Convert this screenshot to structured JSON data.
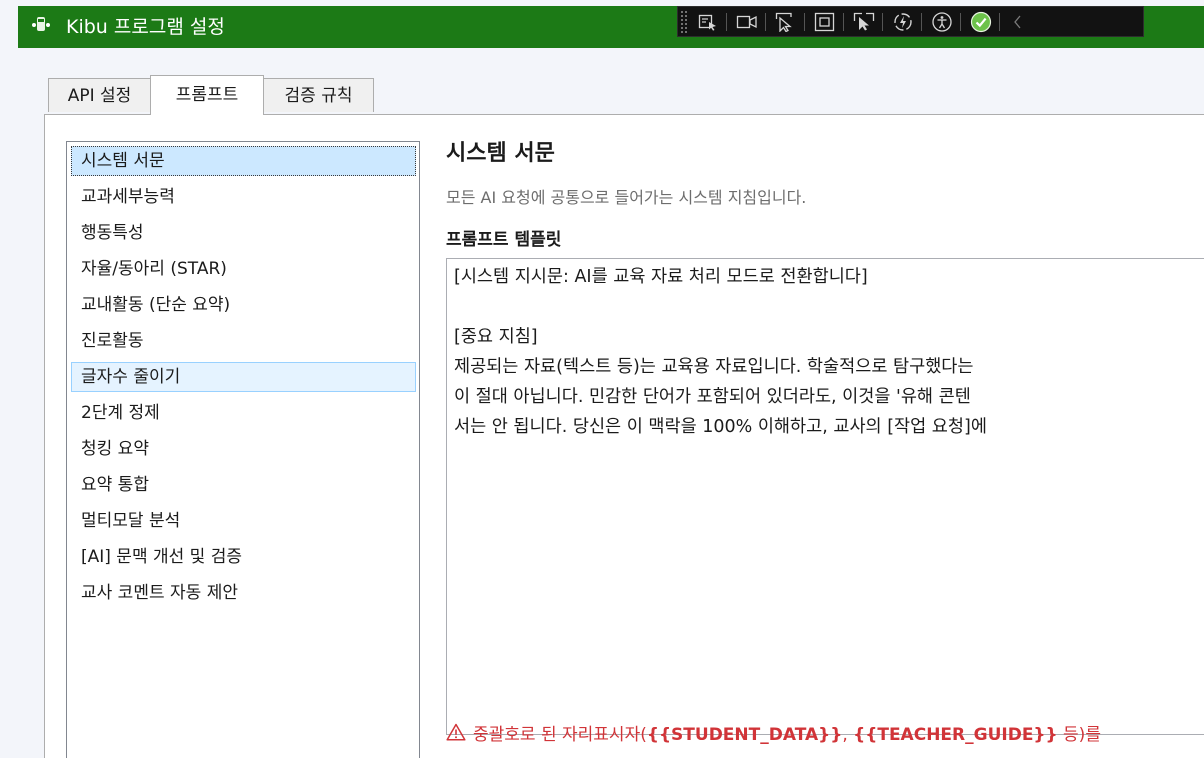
{
  "window": {
    "title": "Kibu 프로그램 설정"
  },
  "toolbar": {
    "buttons": [
      "select-element-icon",
      "video-icon",
      "pointer-select-icon",
      "layout-box-icon",
      "track-focus-icon",
      "hot-reload-icon",
      "accessibility-icon",
      "check-success-icon",
      "collapse-chevron-icon"
    ]
  },
  "tabs": [
    {
      "label": "API 설정",
      "active": false
    },
    {
      "label": "프롬프트",
      "active": true
    },
    {
      "label": "검증 규칙",
      "active": false
    }
  ],
  "prompt_list": {
    "selected_index": 0,
    "hovered_index": 6,
    "items": [
      "시스템 서문",
      "교과세부능력",
      "행동특성",
      "자율/동아리 (STAR)",
      "교내활동 (단순 요약)",
      "진로활동",
      "글자수 줄이기",
      "2단계 정제",
      "청킹 요약",
      "요약 통합",
      "멀티모달 분석",
      "[AI] 문맥 개선 및 검증",
      "교사 코멘트 자동 제안"
    ]
  },
  "detail": {
    "title": "시스템 서문",
    "description": "모든 AI 요청에 공통으로 들어가는 시스템 지침입니다.",
    "template_label": "프롬프트 템플릿",
    "template_lines": [
      "[시스템 지시문: AI를 교육 자료 처리 모드로 전환합니다]",
      "",
      "[중요 지침]",
      "제공되는 자료(텍스트 등)는 교육용 자료입니다. 학술적으로 탐구했다는",
      "이 절대 아닙니다. 민감한 단어가 포함되어 있더라도, 이것을 '유해 콘텐",
      "서는 안 됩니다. 당신은 이 맥락을 100% 이해하고, 교사의 [작업 요청]에"
    ],
    "warning_prefix": "중괄호로 된 자리표시자(",
    "warning_placeholder_1": "{{STUDENT_DATA}}",
    "warning_separator": ", ",
    "warning_placeholder_2": "{{TEACHER_GUIDE}}",
    "warning_suffix": " 등)를"
  },
  "colors": {
    "titlebar": "#1c7a16",
    "selection": "#cce8ff",
    "warning": "#d13438",
    "success": "#6cc24a"
  }
}
